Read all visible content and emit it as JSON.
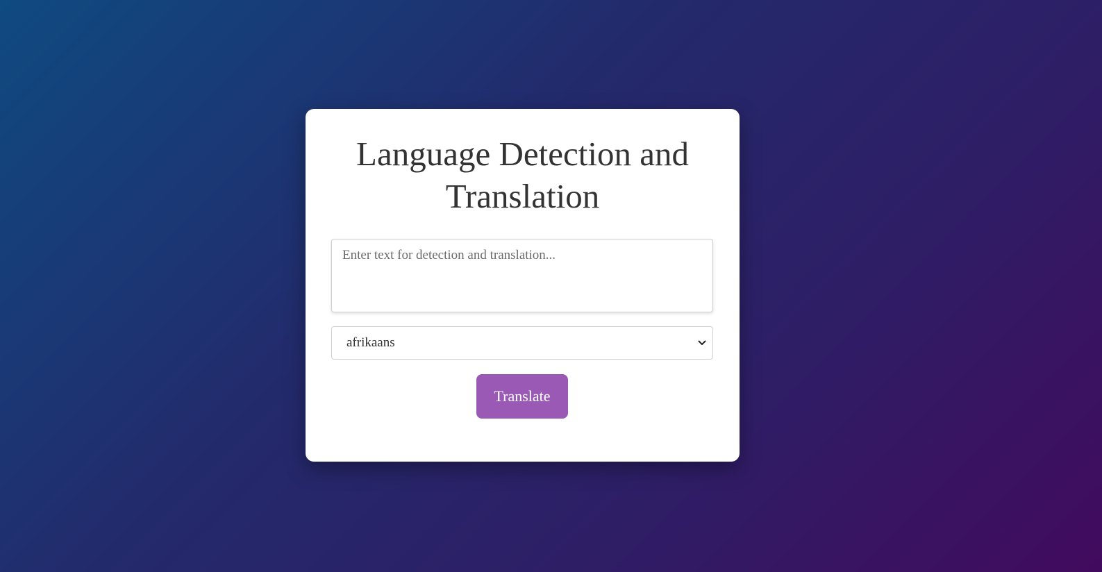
{
  "page": {
    "title": "Language Detection and Translation"
  },
  "input": {
    "placeholder": "Enter text for detection and translation...",
    "value": ""
  },
  "language_select": {
    "selected": "afrikaans",
    "icon": "chevron-down-icon"
  },
  "actions": {
    "translate_label": "Translate"
  },
  "colors": {
    "accent": "#9b59b6",
    "background_start": "#0f4a80",
    "background_end": "#420a5e",
    "card": "#ffffff",
    "title_text": "#333333"
  }
}
